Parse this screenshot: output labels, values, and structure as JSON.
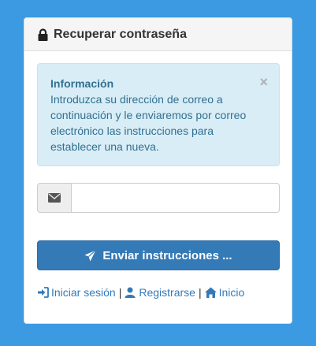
{
  "panel": {
    "title": "Recuperar contraseña",
    "title_icon": "lock-icon"
  },
  "alert": {
    "title": "Información",
    "message": "Introduzca su dirección de correo a continuación y le enviaremos por correo electrónico las instrucciones para establecer una nueva.",
    "close_label": "×"
  },
  "email": {
    "icon": "envelope-icon",
    "value": "",
    "placeholder": ""
  },
  "submit": {
    "label": "Enviar instrucciones ...",
    "icon": "paper-plane-icon"
  },
  "links": {
    "login": "Iniciar sesión",
    "register": "Registrarse",
    "home": "Inicio",
    "separator": "|"
  },
  "colors": {
    "background": "#3b9ae1",
    "primary": "#337ab7",
    "alert_bg": "#d9edf7",
    "alert_text": "#31708f"
  }
}
